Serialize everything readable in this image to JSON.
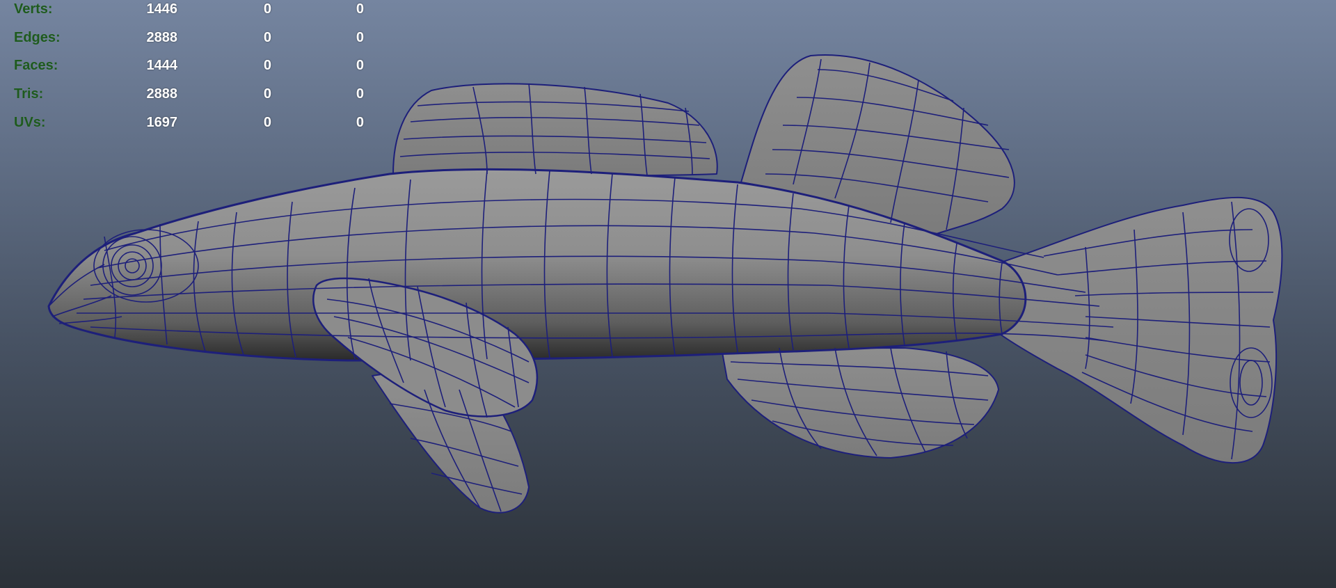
{
  "hud": {
    "rows": [
      {
        "label": "Verts:",
        "v1": "1446",
        "v2": "0",
        "v3": "0"
      },
      {
        "label": "Edges:",
        "v1": "2888",
        "v2": "0",
        "v3": "0"
      },
      {
        "label": "Faces:",
        "v1": "1444",
        "v2": "0",
        "v3": "0"
      },
      {
        "label": "Tris:",
        "v1": "2888",
        "v2": "0",
        "v3": "0"
      },
      {
        "label": "UVs:",
        "v1": "1697",
        "v2": "0",
        "v3": "0"
      }
    ]
  },
  "colors": {
    "label": "#1e5a1e",
    "value": "#ffffff",
    "wireframe": "#1d1f7a",
    "mesh_surface": "#8d8d8d"
  }
}
